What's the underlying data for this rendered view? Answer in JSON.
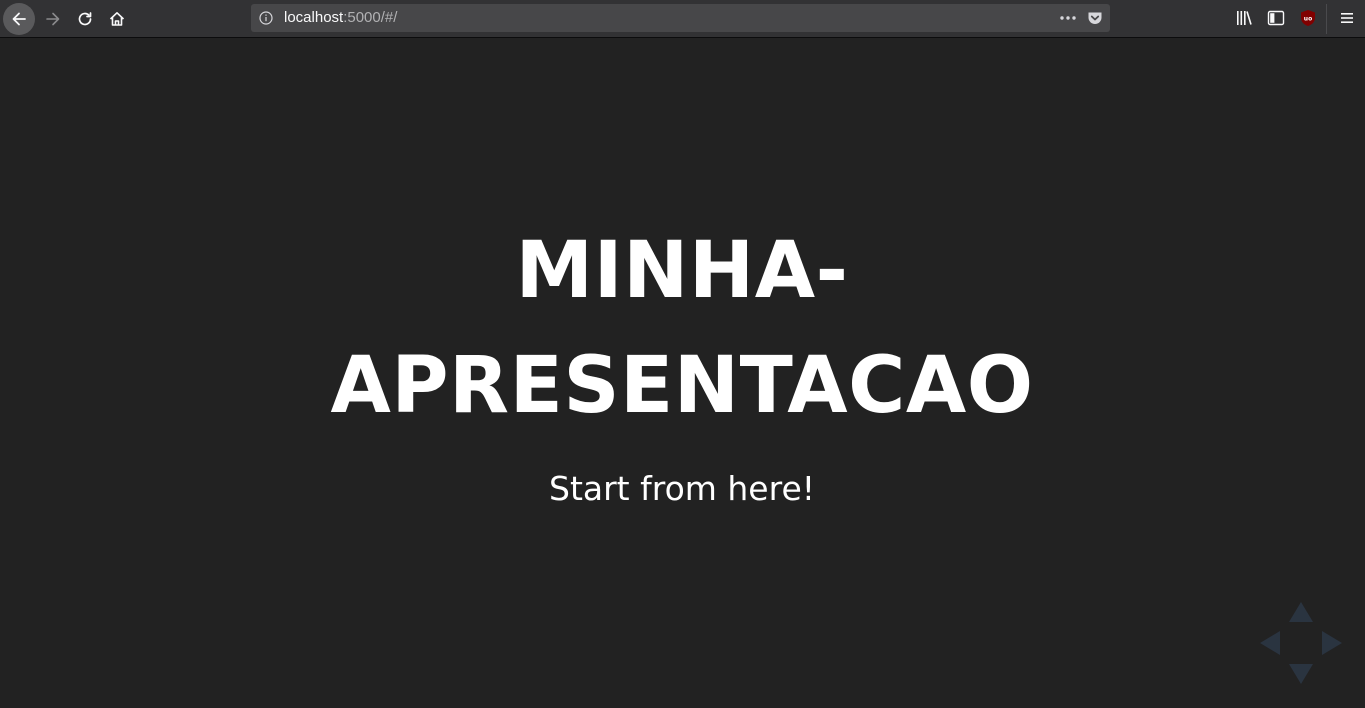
{
  "browser": {
    "url_host": "localhost",
    "url_rest": ":5000/#/",
    "icons": [
      "back-arrow-icon",
      "forward-arrow-icon",
      "reload-icon",
      "home-icon",
      "info-icon",
      "more-dots-icon",
      "pocket-icon",
      "library-icon",
      "sidebar-icon",
      "ublock-origin-icon",
      "hamburger-menu-icon"
    ],
    "colors": {
      "toolbar": "#323234",
      "urlbar": "#474749",
      "ublock": "#800000"
    }
  },
  "slide": {
    "title_line1": "MINHA-",
    "title_line2": "APRESENTACAO",
    "subtitle": "Start from here!",
    "background": "#222222",
    "control_color": "#2a3440"
  }
}
